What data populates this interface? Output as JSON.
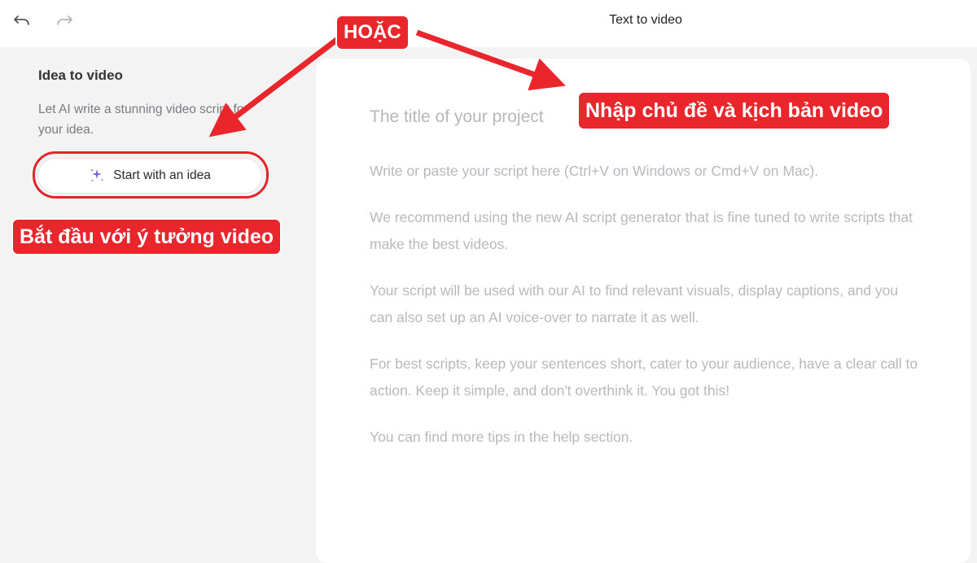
{
  "topbar": {
    "title": "Text to video",
    "undo_icon": "undo-icon",
    "redo_icon": "redo-icon"
  },
  "sidebar": {
    "heading": "Idea to video",
    "description": "Let AI write a stunning video script for your idea.",
    "start_button": {
      "label": "Start with an idea",
      "icon": "sparkle-icon"
    }
  },
  "editor": {
    "title_placeholder": "The title of your project",
    "script_placeholder": [
      "Write or paste your script here (Ctrl+V on Windows or Cmd+V on Mac).",
      "We recommend using the new AI script generator that is fine tuned to write scripts that make the best videos.",
      "Your script will be used with our AI to find relevant visuals, display captions, and you can also set up an AI voice-over to narrate it as well.",
      "For best scripts, keep your sentences short, cater to your audience, have a clear call to action. Keep it simple, and don't overthink it. You got this!",
      "You can find more tips in the help section."
    ]
  },
  "annotations": {
    "or_label": "HOẶC",
    "enter_topic_label": "Nhập chủ đề và kịch bản video",
    "start_idea_label": "Bắt đầu với ý tưởng video"
  },
  "colors": {
    "annotation_red": "#e8262b",
    "sparkle_purple": "#7c5ce0",
    "app_background": "#f3f3f4",
    "panel_background": "#ffffff"
  }
}
